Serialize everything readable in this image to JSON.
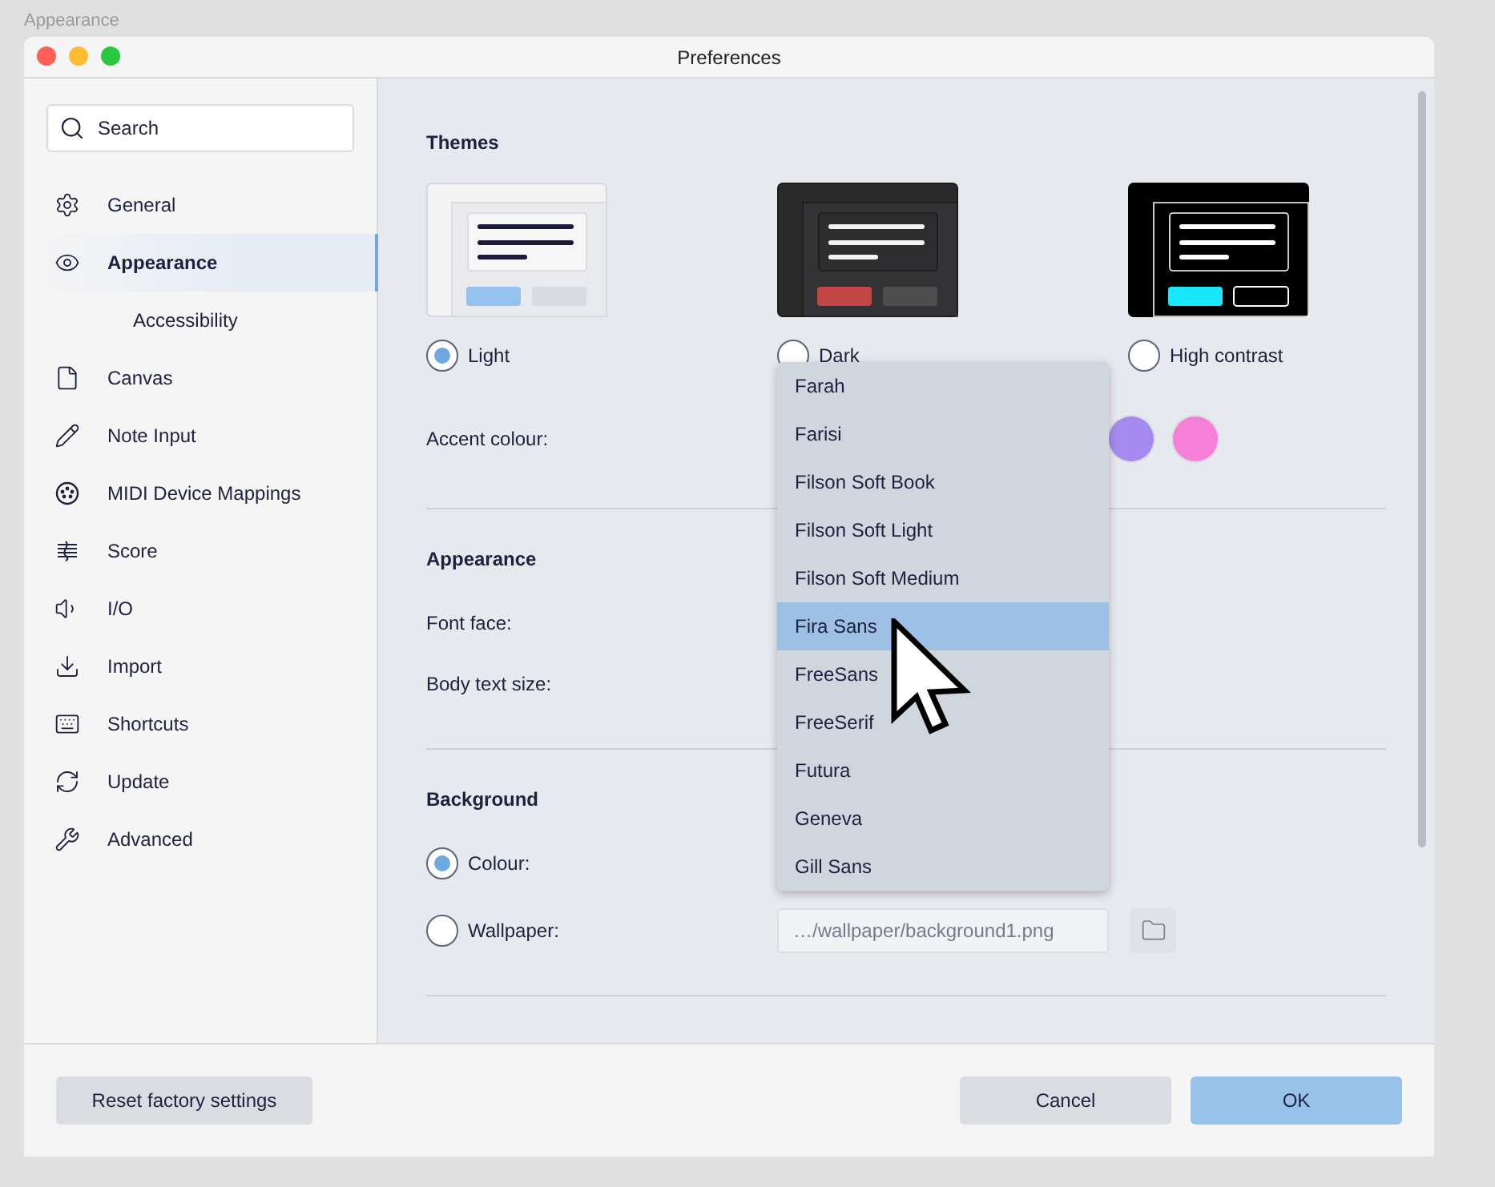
{
  "caption": "Appearance",
  "window": {
    "title": "Preferences"
  },
  "search": {
    "placeholder": "Search"
  },
  "sidebar": {
    "items": [
      {
        "label": "General",
        "selected": false
      },
      {
        "label": "Appearance",
        "selected": true,
        "children": [
          {
            "label": "Accessibility",
            "selected": false
          }
        ]
      },
      {
        "label": "Canvas",
        "selected": false
      },
      {
        "label": "Note Input",
        "selected": false
      },
      {
        "label": "MIDI Device Mappings",
        "selected": false
      },
      {
        "label": "Score",
        "selected": false
      },
      {
        "label": "I/O",
        "selected": false
      },
      {
        "label": "Import",
        "selected": false
      },
      {
        "label": "Shortcuts",
        "selected": false
      },
      {
        "label": "Update",
        "selected": false
      },
      {
        "label": "Advanced",
        "selected": false
      }
    ]
  },
  "themes": {
    "heading": "Themes",
    "options": [
      {
        "label": "Light",
        "kind": "light",
        "selected": true
      },
      {
        "label": "Dark",
        "kind": "dark",
        "selected": false
      },
      {
        "label": "High contrast",
        "kind": "contrast",
        "selected": false
      }
    ]
  },
  "accent": {
    "label": "Accent colour:",
    "swatches": [
      {
        "color": "#a58bef"
      },
      {
        "color": "#f67fd9"
      }
    ]
  },
  "appearance": {
    "heading": "Appearance",
    "font_face_label": "Font face:",
    "body_text_size_label": "Body text size:"
  },
  "font_dropdown": {
    "options": [
      {
        "label": "Farah",
        "selected": false
      },
      {
        "label": "Farisi",
        "selected": false
      },
      {
        "label": "Filson Soft Book",
        "selected": false
      },
      {
        "label": "Filson Soft Light",
        "selected": false
      },
      {
        "label": "Filson Soft Medium",
        "selected": false
      },
      {
        "label": "Fira Sans",
        "selected": true
      },
      {
        "label": "FreeSans",
        "selected": false
      },
      {
        "label": "FreeSerif",
        "selected": false
      },
      {
        "label": "Futura",
        "selected": false
      },
      {
        "label": "Geneva",
        "selected": false
      },
      {
        "label": "Gill Sans",
        "selected": false
      }
    ]
  },
  "background": {
    "heading": "Background",
    "options": [
      {
        "label": "Colour:",
        "kind": "colour",
        "selected": true
      },
      {
        "label": "Wallpaper:",
        "kind": "wallpaper",
        "selected": false,
        "value": "…/wallpaper/background1.png"
      }
    ]
  },
  "buttons": {
    "reset": "Reset factory settings",
    "cancel": "Cancel",
    "ok": "OK"
  }
}
